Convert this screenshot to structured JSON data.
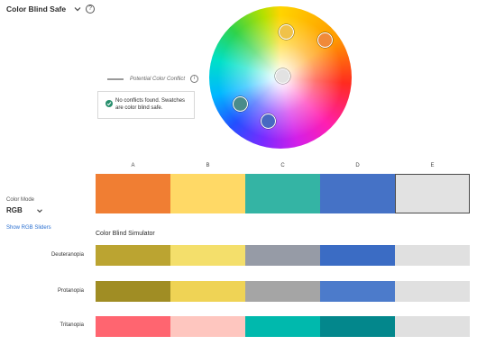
{
  "header": {
    "rule_title": "Color Blind Safe",
    "help_glyph": "?"
  },
  "wheel": {
    "handles": [
      {
        "name": "handle-a",
        "color": "#F0C24A"
      },
      {
        "name": "handle-b",
        "color": "#F08A3A"
      },
      {
        "name": "handle-c",
        "color": "#E2E2E2"
      },
      {
        "name": "handle-d",
        "color": "#4A8C8A"
      },
      {
        "name": "handle-e",
        "color": "#4869C2"
      }
    ]
  },
  "conflict_legend": {
    "label": "Potential Color Conflict",
    "info_glyph": "i"
  },
  "status": {
    "message": "No conflicts found. Swatches are color blind safe.",
    "color": "#268E6C"
  },
  "columns": [
    "A",
    "B",
    "C",
    "D",
    "E"
  ],
  "swatches": [
    {
      "label": "A",
      "color": "#F07E33"
    },
    {
      "label": "B",
      "color": "#FFD966"
    },
    {
      "label": "C",
      "color": "#34B4A4"
    },
    {
      "label": "D",
      "color": "#4572C6"
    },
    {
      "label": "E",
      "color": "#E2E2E2",
      "selected": true
    }
  ],
  "color_mode": {
    "label": "Color Mode",
    "value": "RGB",
    "sliders_link": "Show RGB Sliders",
    "link_color": "#2A6FD0"
  },
  "simulator": {
    "title": "Color Blind Simulator",
    "rows": [
      {
        "label": "Deuteranopia",
        "colors": [
          "#BBA431",
          "#F4DF6B",
          "#969BA6",
          "#3B6CC4",
          "#E0E0E0"
        ]
      },
      {
        "label": "Protanopia",
        "colors": [
          "#A08D24",
          "#EFD355",
          "#A5A5A5",
          "#4C7BCB",
          "#E0E0E0"
        ]
      },
      {
        "label": "Tritanopia",
        "colors": [
          "#FF6570",
          "#FEC6BF",
          "#00B9AD",
          "#03878C",
          "#E0E0E0"
        ]
      }
    ]
  }
}
